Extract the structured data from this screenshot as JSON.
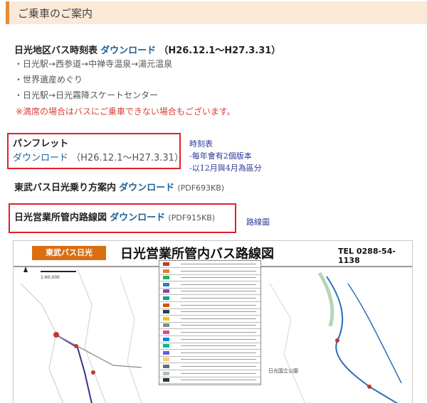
{
  "header": {
    "title": "ご乗車のご案内"
  },
  "bus_timetable": {
    "title": "日光地区バス時刻表",
    "download_label": "ダウンロード",
    "period": "（H26.12.1～H27.3.31）",
    "routes": [
      "・日光駅→西参道→中禅寺温泉→湯元温泉",
      "・世界遺産めぐり",
      "・日光駅→日光霧降スケートセンター"
    ],
    "note": "※満席の場合はバスにご乗車できない場合もございます。"
  },
  "pamphlet": {
    "title": "パンフレット",
    "download_label": "ダウンロード",
    "period": "（H26.12.1～H27.3.31）"
  },
  "pamphlet_annotation": [
    "時刻表",
    "-每年會有2個版本",
    "-以12月與4月為區分"
  ],
  "boarding_guide": {
    "title": "東武バス日光乗り方案内",
    "download_label": "ダウンロード",
    "file_info": "(PDF693KB)"
  },
  "route_map": {
    "title": "日光営業所管内路線図",
    "download_label": "ダウンロード",
    "file_info": "(PDF915KB)"
  },
  "route_map_annotation": "路線圖",
  "map_preview": {
    "badge": "東武バス日光",
    "title": "日光営業所管内バス路線図",
    "tel": "TEL 0288-54-1138",
    "scale": "1:60,000",
    "area_label": "日光国立公園",
    "legend_colors": [
      "#c0392b",
      "#e67e22",
      "#27ae60",
      "#2980b9",
      "#8e44ad",
      "#16a085",
      "#d35400",
      "#2c3e50",
      "#f1c40f",
      "#7f8c8d",
      "#e84393",
      "#0984e3",
      "#00b894",
      "#6c5ce7",
      "#fdcb6e",
      "#636e72",
      "#b2bec3",
      "#2d3436"
    ]
  }
}
